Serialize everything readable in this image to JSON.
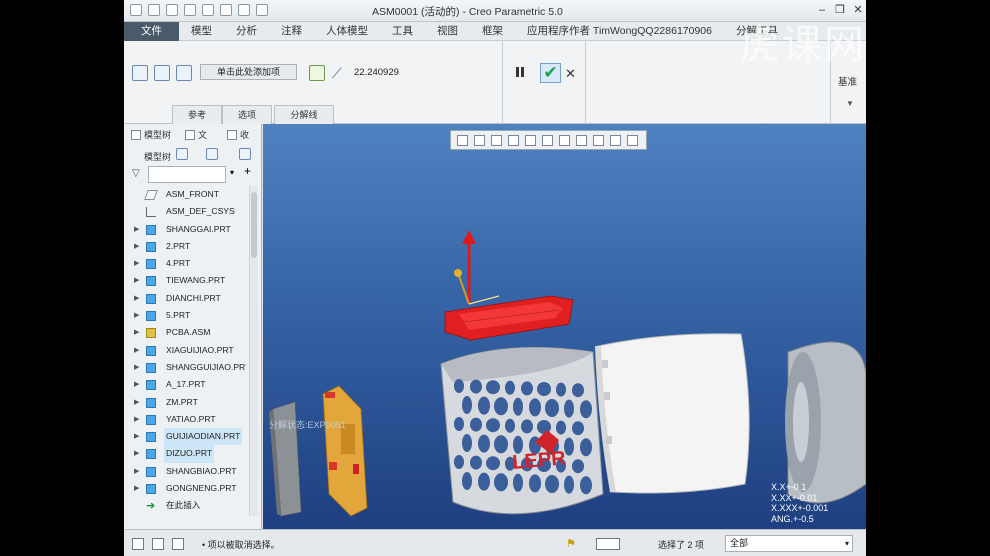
{
  "window": {
    "title": "ASM0001 (活动的) - Creo Parametric 5.0",
    "minimize": "–",
    "restore": "❐",
    "close": "✕"
  },
  "menubar": [
    "文件",
    "模型",
    "分析",
    "注释",
    "人体模型",
    "工具",
    "视图",
    "框架",
    "应用程序作者 TimWongQQ2286170906",
    "分解工具"
  ],
  "ribbon": {
    "add_item": "单击此处添加项",
    "angle_value": "22.240929",
    "base_label": "基准",
    "tabs": [
      "参考",
      "选项",
      "分解线"
    ]
  },
  "panel": {
    "tabs": [
      "模型树",
      "文",
      "收"
    ],
    "tree_label": "模型树",
    "items": [
      {
        "label": "ASM_FRONT",
        "icon": "plane",
        "expandable": false,
        "selected": false
      },
      {
        "label": "ASM_DEF_CSYS",
        "icon": "csys",
        "expandable": false,
        "selected": false
      },
      {
        "label": "SHANGGAI.PRT",
        "icon": "part",
        "expandable": true,
        "selected": false
      },
      {
        "label": "2.PRT",
        "icon": "part",
        "expandable": true,
        "selected": false
      },
      {
        "label": "4.PRT",
        "icon": "part",
        "expandable": true,
        "selected": false
      },
      {
        "label": "TIEWANG.PRT",
        "icon": "part",
        "expandable": true,
        "selected": false
      },
      {
        "label": "DIANCHI.PRT",
        "icon": "part",
        "expandable": true,
        "selected": false
      },
      {
        "label": "5.PRT",
        "icon": "part",
        "expandable": true,
        "selected": false
      },
      {
        "label": "PCBA.ASM",
        "icon": "asm",
        "expandable": true,
        "selected": false
      },
      {
        "label": "XIAGUIJIAO.PRT",
        "icon": "part",
        "expandable": true,
        "selected": false
      },
      {
        "label": "SHANGGUIJIAO.PRT",
        "icon": "part",
        "expandable": true,
        "selected": false
      },
      {
        "label": "A_17.PRT",
        "icon": "part",
        "expandable": true,
        "selected": false
      },
      {
        "label": "ZM.PRT",
        "icon": "part",
        "expandable": true,
        "selected": false
      },
      {
        "label": "YATIAO.PRT",
        "icon": "part",
        "expandable": true,
        "selected": false
      },
      {
        "label": "GUIJIAODIAN.PRT",
        "icon": "part",
        "expandable": true,
        "selected": true
      },
      {
        "label": "DIZUO.PRT",
        "icon": "part",
        "expandable": true,
        "selected": true
      },
      {
        "label": "SHANGBIAO.PRT",
        "icon": "part",
        "expandable": true,
        "selected": false
      },
      {
        "label": "GONGNENG.PRT",
        "icon": "part",
        "expandable": true,
        "selected": false
      },
      {
        "label": "在此插入",
        "icon": "insert",
        "expandable": false,
        "selected": false
      }
    ]
  },
  "viewport": {
    "explode_state": "分解状态:EXP0001",
    "tolerance": [
      "X.X+-0.1",
      "X.XX+-0.01",
      "X.XXX+-0.001",
      "ANG.+-0.5"
    ],
    "logo_text": "LEPR",
    "colors": {
      "highlight": "#e02020",
      "background_top": "#4f82c0",
      "background_bottom": "#1e3f80"
    }
  },
  "status": {
    "message": "• 项以被取消选择。",
    "selection_count": "选择了 2 项",
    "filter_value": "全部"
  },
  "watermark": "虎课网"
}
